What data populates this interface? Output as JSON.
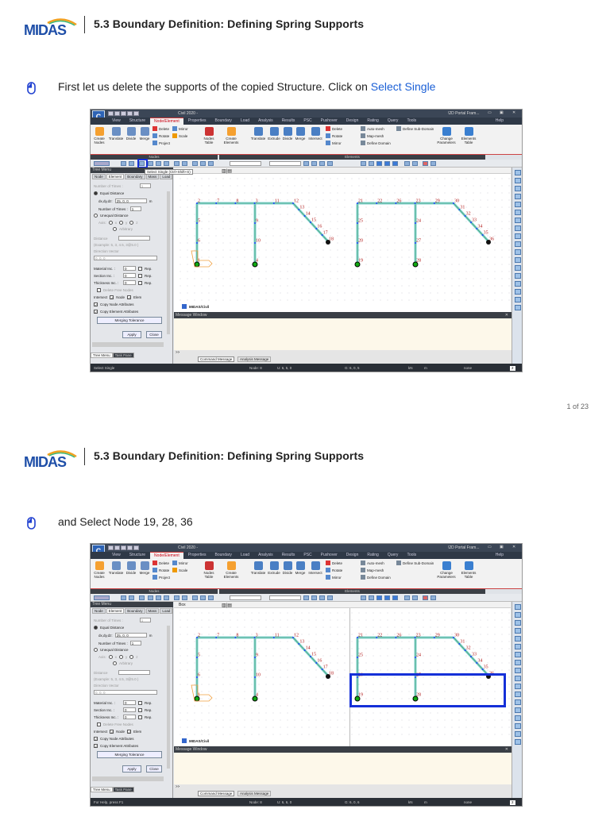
{
  "document": {
    "logo_text": "MIDAS",
    "page_number": "1 of 23",
    "pages": [
      {
        "title": "5.3 Boundary Definition: Defining Spring Supports",
        "instruction": "First let us delete the supports of the copied Structure.   Click on ",
        "instruction_link": "Select Single"
      },
      {
        "title": "5.3 Boundary Definition: Defining Spring Supports",
        "instruction": "and Select Node 19, 28, 36",
        "instruction_link": ""
      }
    ]
  },
  "app": {
    "title": "Civil 2020 -",
    "project": "\\2D Portal Fram...",
    "help": "Help",
    "menu_tabs": [
      "View",
      "Structure",
      "Node/Element",
      "Properties",
      "Boundary",
      "Load",
      "Analysis",
      "Results",
      "PSC",
      "Pushover",
      "Design",
      "Rating",
      "Query",
      "Tools"
    ],
    "active_tab": "Node/Element",
    "ribbon": {
      "create_nodes": "Create Nodes",
      "translate": "Translate",
      "divide": "Divide",
      "merge": "Merge",
      "delete": "Delete",
      "rotate": "Rotate",
      "project": "Project",
      "mirror": "Mirror",
      "scale": "Scale",
      "nodes_table": "Nodes Table",
      "create_elements": "Create Elements",
      "translate_e": "Translate",
      "extrude": "Extrude",
      "divide_e": "Divide",
      "merge_e": "Merge",
      "intersect": "Intersect",
      "delete_e": "Delete",
      "rotate_e": "Rotate",
      "mirror_e": "Mirror",
      "auto_mesh": "Auto-mesh",
      "map_mesh": "Map-mesh",
      "define_domain": "Define Domain",
      "define_sub_domain": "Define Sub-Domain",
      "change_parameters": "Change Parameters",
      "elements_table": "Elements Table",
      "group_nodes": "Nodes",
      "group_elements": "Elements"
    },
    "tree_menu": {
      "header": "Tree Menu",
      "tabs": [
        "Node",
        "Element",
        "Boundary",
        "Mass",
        "Load"
      ],
      "active_tab": "Element",
      "number_of_times_label": "Number of Times :",
      "number_of_times_top": "1",
      "equal_distance": "Equal Distance",
      "dxdydz_label": "dx,dy,dz:",
      "dxdydz": "25, 0, 0",
      "unit_m": "m",
      "number_of_times": "1",
      "unequal_distance": "Unequal Distance",
      "axis_label": "Axis:",
      "axis_x": "x",
      "axis_y": "y",
      "axis_z": "z",
      "arbitrary": "Arbitrary",
      "distance_label": "Distance",
      "example": "(Example:   5, 3, 4.5, 3@5.0 )",
      "direction_vector_label": "Direction Vector",
      "direction_vector": "0, 0, 0",
      "material_inc": "Material Inc. :",
      "section_inc": "Section Inc. :",
      "thickness_inc": "Thickness Inc. :",
      "inc_value": "0",
      "rep": "Rep.",
      "delete_free_nodes": "Delete Free Nodes",
      "intersect": "Intersect",
      "node": "Node",
      "elem": "Elem",
      "copy_node_attr": "Copy Node Attributes",
      "copy_elem_attr": "Copy Element Attributes",
      "merging_tolerance": "Merging Tolerance",
      "apply": "Apply",
      "close": "Close",
      "bottom_tabs": [
        "Tree Menu",
        "Task Pane"
      ]
    },
    "view_tab": "MIDAS/Civil",
    "message_window": "Message Window",
    "prompt": ">>",
    "msg_tabs": [
      "Command Message",
      "Analysis Message"
    ],
    "units": {
      "force": "kN",
      "length": "m",
      "none": "none",
      "page": "2"
    },
    "frames": [
      {
        "top": [
          "2",
          "7",
          "8",
          "3",
          "11",
          "12"
        ],
        "diag": [
          "13",
          "14",
          "15",
          "16",
          "17",
          "18"
        ],
        "col1": [
          "5",
          "6",
          "1"
        ],
        "col2": [
          "9",
          "10",
          "4"
        ]
      },
      {
        "top": [
          "21",
          "22",
          "26",
          "23",
          "29",
          "30"
        ],
        "diag": [
          "31",
          "32",
          "33",
          "34",
          "35",
          "36"
        ],
        "col1": [
          "25",
          "20",
          "19"
        ],
        "col2": [
          "24",
          "27",
          "28"
        ]
      }
    ],
    "colors": {
      "beam": "#7fd0d0",
      "node": "#1e3cff",
      "label": "#b01818",
      "highlight": "#1530d8"
    }
  },
  "shots": [
    {
      "tooltip": "Select Single (Ctrl+Shift+S)",
      "view_name": "",
      "status_text": "Select Single",
      "status_node": "Node: 8",
      "status_u": "U: 6, 5, 0",
      "status_g": "G: 6, 0, 5"
    },
    {
      "tooltip": "",
      "view_name": "Box",
      "status_text": "For Help, press F1",
      "status_node": "Node: 8",
      "status_u": "U: 6, 6, 0",
      "status_g": "G: 6, 0, 6"
    }
  ]
}
